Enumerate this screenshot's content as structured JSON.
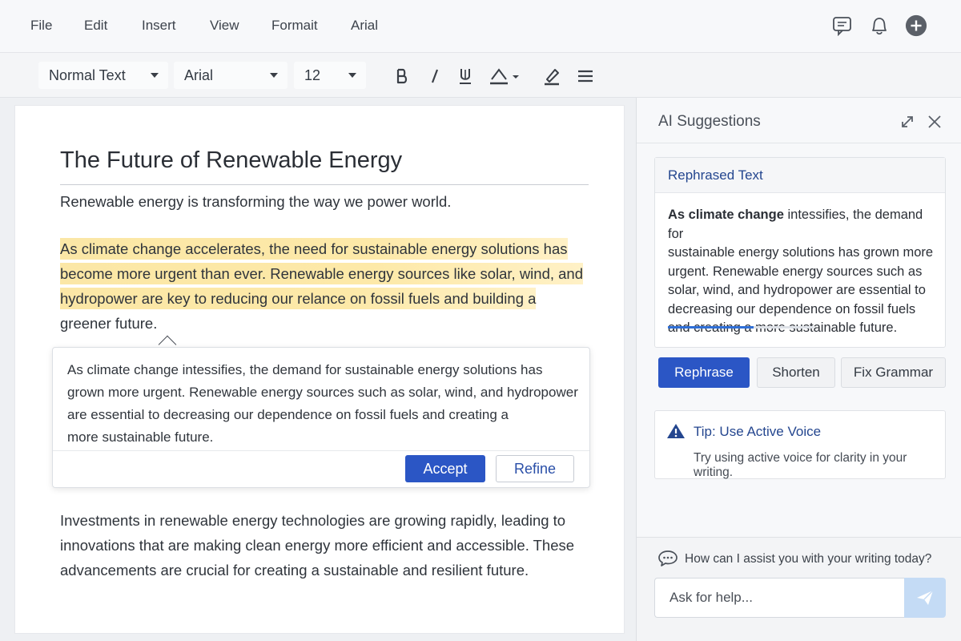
{
  "menu": [
    "File",
    "Edit",
    "Insert",
    "View",
    "Formait",
    "Arial"
  ],
  "toolbar": {
    "style_value": "Normal Text",
    "font_value": "Arial",
    "size_value": "12"
  },
  "document": {
    "title": "The Future of Renewable Energy",
    "intro": "Renewable energy is transforming the way we power world.",
    "highlighted": {
      "line1": "As climate change accelerates, the need for sustainable energy solutions has",
      "line2": "become more urgent than ever. Renewable energy sources like solar, wind, and",
      "line3": "hydropower are key to reducing our relance on fossil fuels and building a",
      "line4": "greener future."
    },
    "closing": {
      "line1": "Investments in renewable energy technologies are growing rapidly, leading to",
      "line2": "innovations that are making clean energy more efficient and accessible. These",
      "line3": "advancements are crucial for creating a sustainable and resilient future."
    }
  },
  "popup": {
    "line1": "As climate change intessifies, the demand for sustainable energy solutions has",
    "line2": "grown more urgent. Renewable energy sources such as solar, wind, and hydropower",
    "line3": "are essential to decreasing our dependence on fossil fuels and creating a",
    "line4": "more sustainable future.",
    "accept_label": "Accept",
    "refine_label": "Refine"
  },
  "sidebar": {
    "title": "AI Suggestions",
    "card": {
      "heading": "Rephrased Text",
      "bold_lead": "As climate change",
      "rest_line1": " intessifies, the demand for",
      "line2": "sustainable energy solutions has grown more",
      "line3": "urgent. Renewable energy sources such as",
      "line4": "solar, wind, and hydropower are essential to",
      "line5": "decreasing our dependence on fossil fuels",
      "line6": "and creating a more sustainable future.",
      "progress": 0.59
    },
    "buttons": {
      "rephrase": "Rephrase",
      "shorten": "Shorten",
      "fix_grammar": "Fix Grammar"
    },
    "tip": {
      "title": "Tip: Use Active Voice",
      "text": "Try using active voice for clarity in your writing."
    },
    "chat": {
      "prompt": "How can I assist you with your writing today?",
      "placeholder": "Ask for help..."
    }
  },
  "colors": {
    "accent": "#2b56c5",
    "highlight": "#fbe7a6",
    "heading_blue": "#24468f"
  }
}
